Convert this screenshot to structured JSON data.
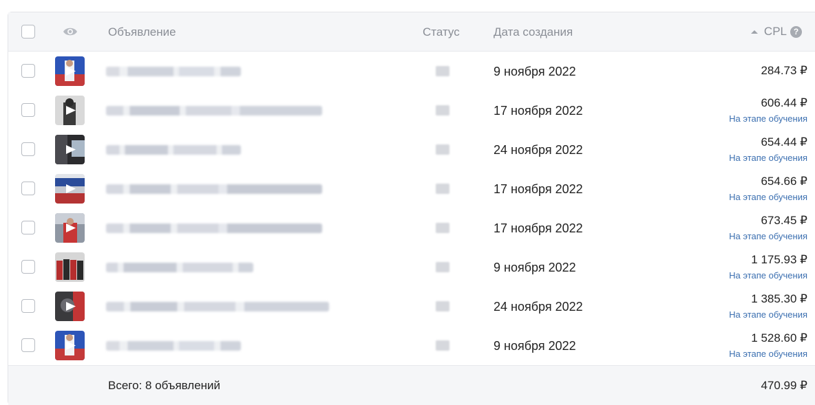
{
  "header": {
    "ad_col": "Объявление",
    "status_col": "Статус",
    "date_col": "Дата создания",
    "cpl_col": "CPL",
    "help_glyph": "?"
  },
  "rows": [
    {
      "date": "9 ноября 2022",
      "cpl": "284.73 ₽",
      "status_note": ""
    },
    {
      "date": "17 ноября 2022",
      "cpl": "606.44 ₽",
      "status_note": "На этапе обучения"
    },
    {
      "date": "24 ноября 2022",
      "cpl": "654.44 ₽",
      "status_note": "На этапе обучения"
    },
    {
      "date": "17 ноября 2022",
      "cpl": "654.66 ₽",
      "status_note": "На этапе обучения"
    },
    {
      "date": "17 ноября 2022",
      "cpl": "673.45 ₽",
      "status_note": "На этапе обучения"
    },
    {
      "date": "9 ноября 2022",
      "cpl": "1 175.93 ₽",
      "status_note": "На этапе обучения"
    },
    {
      "date": "24 ноября 2022",
      "cpl": "1 385.30 ₽",
      "status_note": "На этапе обучения"
    },
    {
      "date": "9 ноября 2022",
      "cpl": "1 528.60 ₽",
      "status_note": "На этапе обучения"
    }
  ],
  "footer": {
    "total_label": "Всего: 8 объявлений",
    "total_cpl": "470.99 ₽"
  },
  "colors": {
    "header_bg": "#f5f6f8",
    "link": "#3b6fb0",
    "muted": "#8a8e96"
  },
  "icons": [
    "checkbox",
    "eye-icon",
    "sort-ascending-icon",
    "help-icon",
    "play-icon"
  ]
}
